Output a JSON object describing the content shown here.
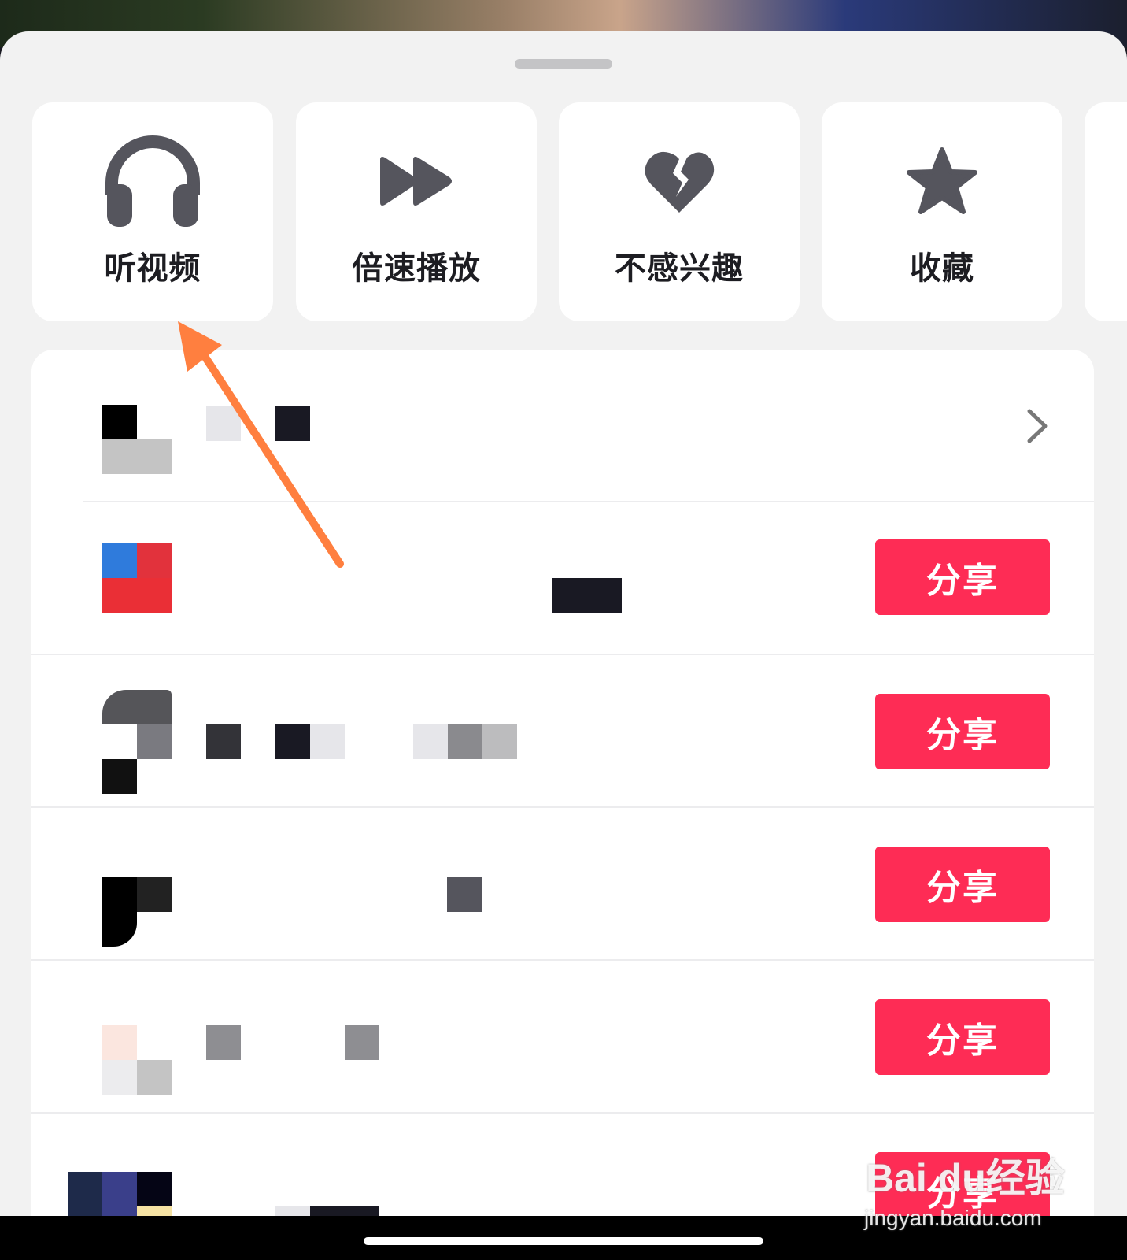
{
  "actions": [
    {
      "label": "听视频",
      "icon": "headphones-icon"
    },
    {
      "label": "倍速播放",
      "icon": "fast-forward-icon"
    },
    {
      "label": "不感兴趣",
      "icon": "broken-heart-icon"
    },
    {
      "label": "收藏",
      "icon": "star-icon"
    }
  ],
  "share_rows": [
    {
      "share_label": "分享"
    },
    {
      "share_label": "分享"
    },
    {
      "share_label": "分享"
    },
    {
      "share_label": "分享"
    },
    {
      "share_label": "分享"
    }
  ],
  "watermark": {
    "logo": "Bai du经验",
    "url": "jingyan.baidu.com"
  },
  "colors": {
    "sheet_bg": "#f2f2f2",
    "card_bg": "#ffffff",
    "icon_gray": "#55555d",
    "share_red": "#fe2c55",
    "annotation_arrow": "#ff7f3f"
  }
}
